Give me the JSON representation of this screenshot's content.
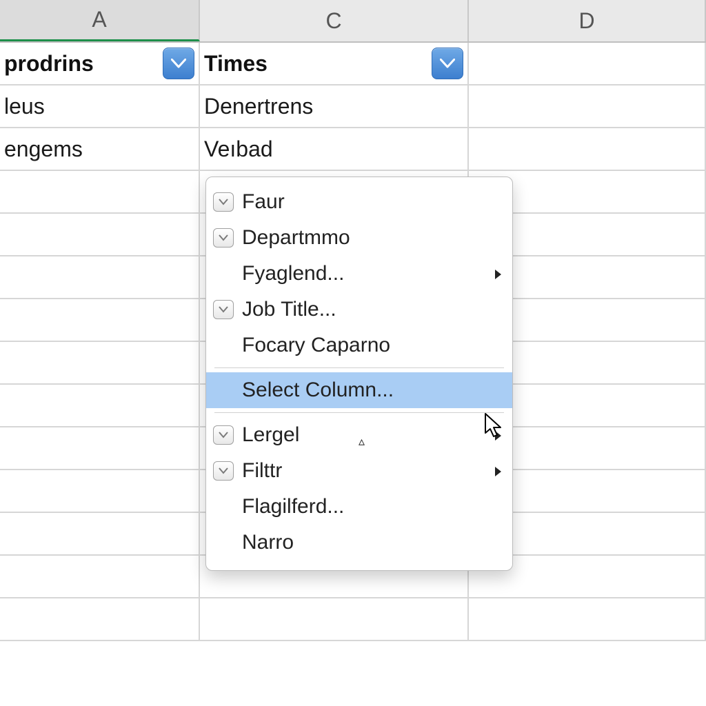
{
  "columns": {
    "A": "A",
    "C": "C",
    "D": "D"
  },
  "grid": {
    "headerRow": {
      "A": "prodrins",
      "C": "Times"
    },
    "rows": [
      {
        "A": "leus",
        "C": "Denertrens"
      },
      {
        "A": "engems",
        "C": "Veıbad"
      }
    ]
  },
  "menu": {
    "items": [
      {
        "label": "Faur",
        "checkable": true,
        "submenu": false
      },
      {
        "label": "Departmmo",
        "checkable": true,
        "submenu": false
      },
      {
        "label": "Fyaglend...",
        "checkable": false,
        "submenu": true
      },
      {
        "label": "Job Title...",
        "checkable": true,
        "submenu": false
      },
      {
        "label": "Focary Caparno",
        "checkable": false,
        "submenu": false
      }
    ],
    "highlighted": "Select Column...",
    "items2": [
      {
        "label": "Lergel",
        "checkable": true,
        "submenu": true
      },
      {
        "label": "Filttr",
        "checkable": true,
        "submenu": true
      },
      {
        "label": "Flagilferd...",
        "checkable": false,
        "submenu": false
      },
      {
        "label": "Narro",
        "checkable": false,
        "submenu": false
      }
    ]
  }
}
